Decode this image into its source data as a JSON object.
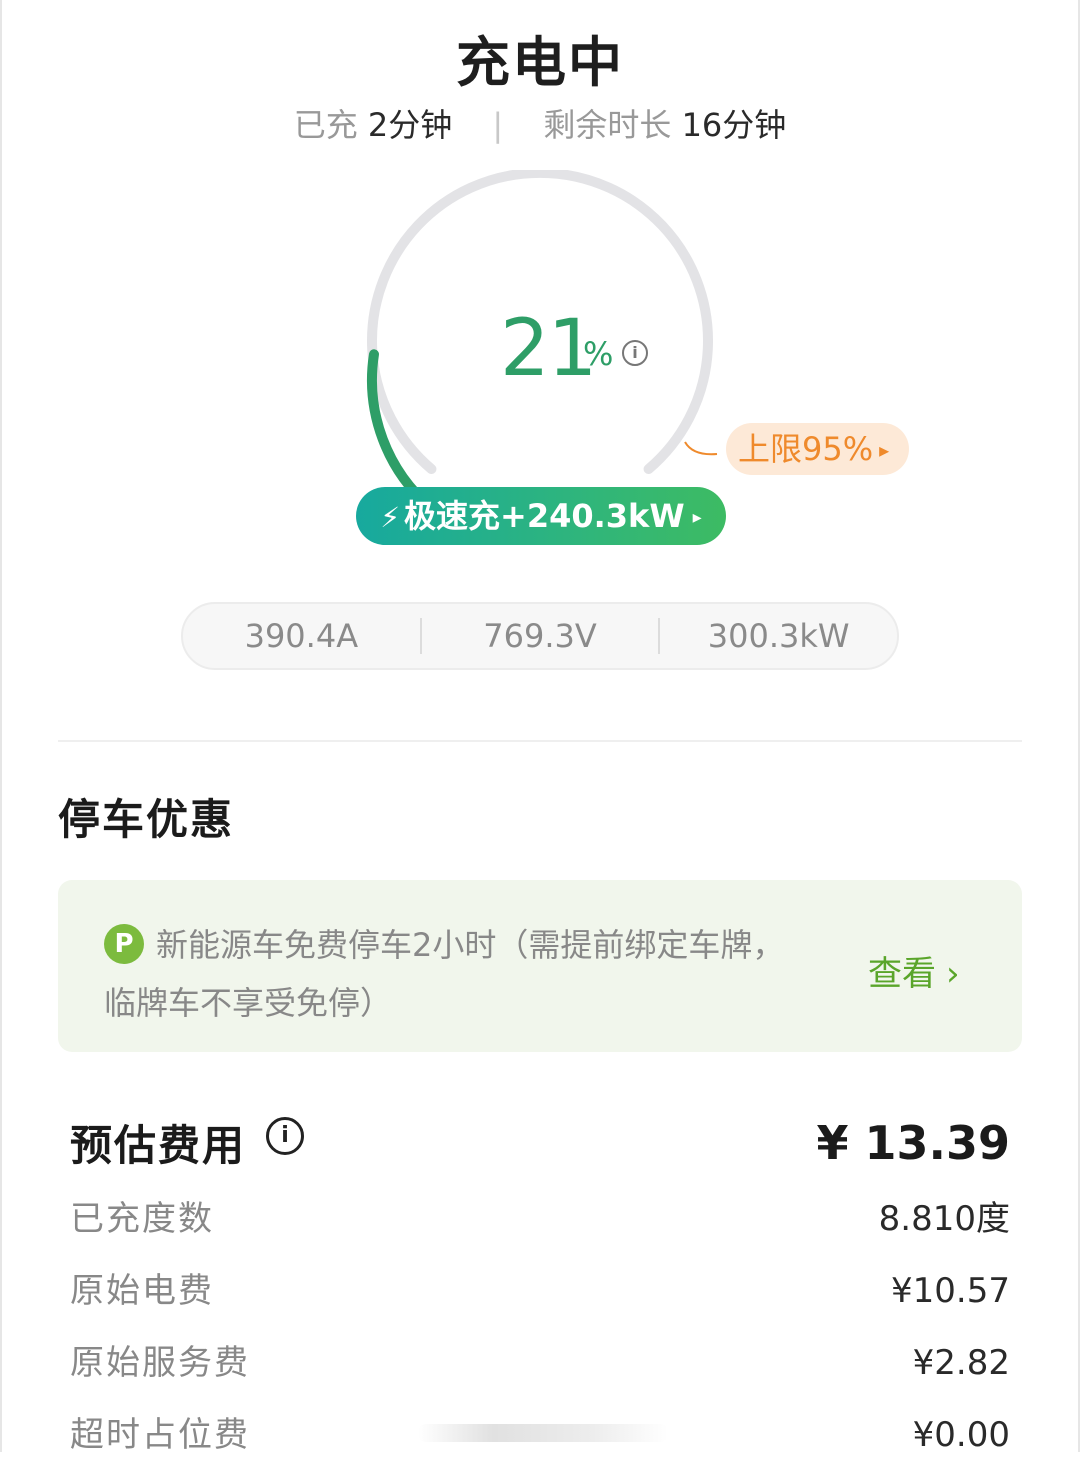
{
  "header": {
    "title": "充电中",
    "charged_label": "已充",
    "charged_value": "2分钟",
    "separator": "|",
    "remaining_label": "剩余时长",
    "remaining_value": "16分钟"
  },
  "gauge": {
    "percent": "21",
    "percent_sign": "%",
    "info_icon": "i",
    "progress_fraction": 0.21,
    "limit_label": "上限95%",
    "limit_arrow": "▸",
    "colors": {
      "progress": "#2e9e67",
      "track": "#e3e3e6",
      "limit": "#ef8a2c"
    }
  },
  "speed": {
    "bolt": "⚡",
    "label": "极速充+240.3kW",
    "arrow": "▸"
  },
  "metrics": {
    "current": "390.4A",
    "voltage": "769.3V",
    "power": "300.3kW"
  },
  "parking": {
    "section_title": "停车优惠",
    "badge": "P",
    "text": "新能源车免费停车2小时（需提前绑定车牌，临牌车不享受免停）",
    "link_label": "查看",
    "link_chevron": "›"
  },
  "fees": {
    "title": "预估费用",
    "info_icon": "i",
    "total": "¥ 13.39",
    "rows": [
      {
        "label": "已充度数",
        "value": "8.810度"
      },
      {
        "label": "原始电费",
        "value": "¥10.57"
      },
      {
        "label": "原始服务费",
        "value": "¥2.82"
      },
      {
        "label": "超时占位费",
        "value": "¥0.00"
      }
    ]
  }
}
